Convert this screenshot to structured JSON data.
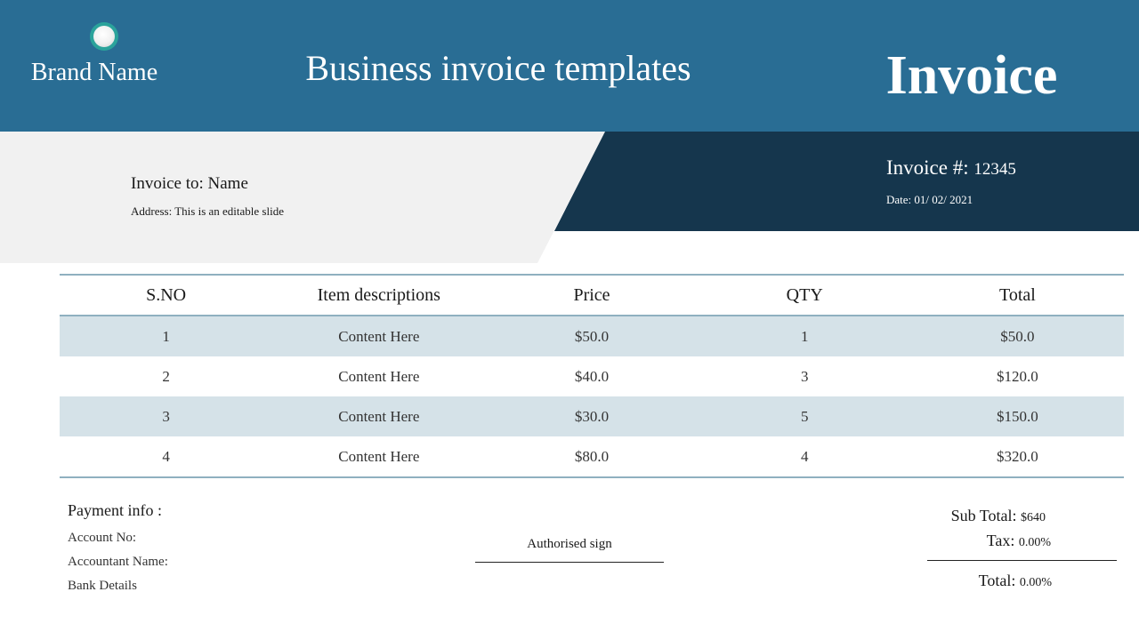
{
  "header": {
    "brand_name": "Brand Name",
    "title": "Business invoice templates",
    "invoice_heading": "Invoice",
    "logo_icon": "circle-logo-icon",
    "colors": {
      "header_bg": "#296d94",
      "dark_panel": "#15364d",
      "light_panel": "#f1f1f1",
      "row_stripe": "#d5e2e8",
      "logo_ring": "#2ba39b"
    }
  },
  "bill_to": {
    "label": "Invoice to: Name",
    "address": "Address: This is an editable slide"
  },
  "invoice_meta": {
    "number_label": "Invoice #:",
    "number": "12345",
    "date": "Date: 01/ 02/ 2021"
  },
  "table": {
    "headers": [
      "S.NO",
      "Item descriptions",
      "Price",
      "QTY",
      "Total"
    ],
    "rows": [
      [
        "1",
        "Content Here",
        "$50.0",
        "1",
        "$50.0"
      ],
      [
        "2",
        "Content Here",
        "$40.0",
        "3",
        "$120.0"
      ],
      [
        "3",
        "Content Here",
        "$30.0",
        "5",
        "$150.0"
      ],
      [
        "4",
        "Content Here",
        "$80.0",
        "4",
        "$320.0"
      ]
    ]
  },
  "payment": {
    "title": "Payment info :",
    "lines": [
      "Account No:",
      "Accountant Name:",
      "Bank Details"
    ]
  },
  "signature": {
    "label": "Authorised sign"
  },
  "totals": {
    "subtotal_label": "Sub Total:",
    "subtotal_value": "$640",
    "tax_label": "Tax:",
    "tax_value": "0.00%",
    "total_label": "Total:",
    "total_value": "0.00%"
  }
}
